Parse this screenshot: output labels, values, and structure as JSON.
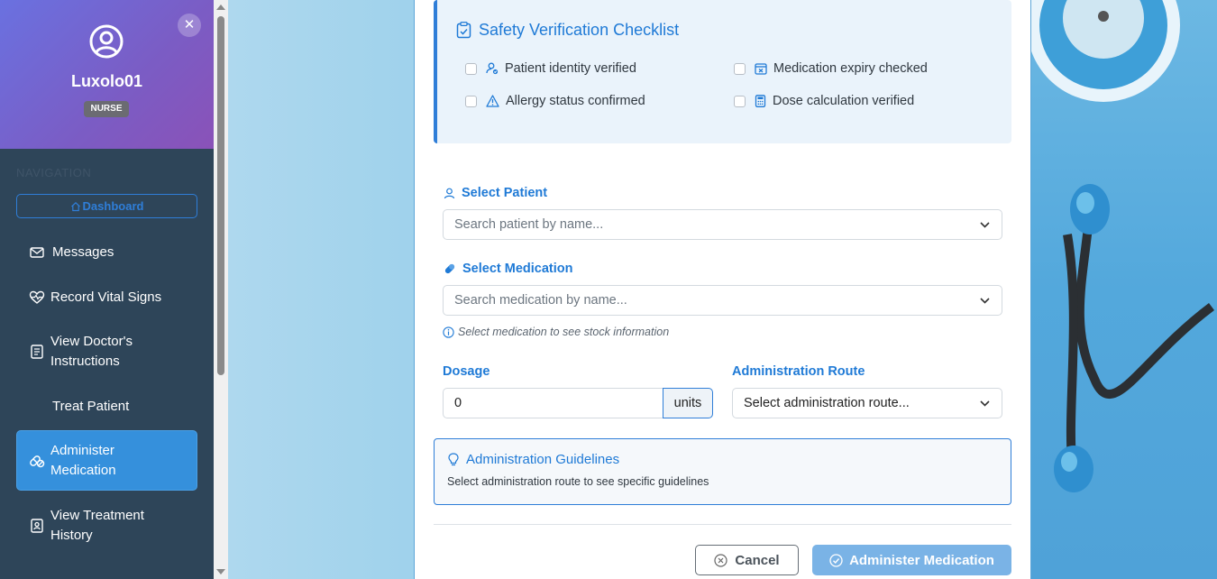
{
  "sidebar": {
    "username": "Luxolo01",
    "role": "NURSE",
    "close_symbol": "✕",
    "nav_heading": "NAVIGATION",
    "dashboard_label": "Dashboard",
    "items": [
      {
        "label": "Messages",
        "icon": "envelope-icon"
      },
      {
        "label": "Record Vital Signs",
        "icon": "heart-pulse-icon"
      },
      {
        "label": "View Doctor's Instructions",
        "icon": "document-icon"
      },
      {
        "label": "Treat Patient",
        "icon": ""
      },
      {
        "label": "Administer Medication",
        "icon": "pills-icon",
        "active": true
      },
      {
        "label": "View Treatment History",
        "icon": "person-card-icon"
      }
    ]
  },
  "checklist": {
    "title": "Safety Verification Checklist",
    "items": [
      {
        "label": "Patient identity verified",
        "icon": "person-check-icon"
      },
      {
        "label": "Medication expiry checked",
        "icon": "calendar-x-icon"
      },
      {
        "label": "Allergy status confirmed",
        "icon": "warning-icon"
      },
      {
        "label": "Dose calculation verified",
        "icon": "calculator-icon"
      }
    ]
  },
  "form": {
    "patient_label": "Select Patient",
    "patient_placeholder": "Search patient by name...",
    "medication_label": "Select Medication",
    "medication_placeholder": "Search medication by name...",
    "medication_hint": "Select medication to see stock information",
    "dosage_label": "Dosage",
    "dosage_value": "0",
    "dosage_unit": "units",
    "route_label": "Administration Route",
    "route_placeholder": "Select administration route..."
  },
  "guidelines": {
    "title": "Administration Guidelines",
    "text": "Select administration route to see specific guidelines"
  },
  "actions": {
    "cancel_label": "Cancel",
    "submit_label": "Administer Medication"
  },
  "colors": {
    "accent": "#1f7ad6",
    "sidebar_bg": "#2e4559",
    "active_nav": "#3590dc",
    "submit_disabled": "#7ab3e6"
  }
}
